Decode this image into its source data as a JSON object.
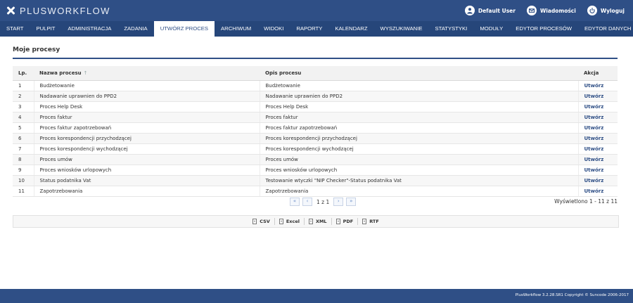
{
  "brand": {
    "logo_text": "PLUSWORKFLOW",
    "logo_icon": "cross-icon"
  },
  "user_menu": [
    {
      "label": "Default User",
      "icon": "user-icon"
    },
    {
      "label": "Wiadomości",
      "icon": "mail-icon"
    },
    {
      "label": "Wyloguj",
      "icon": "power-icon"
    }
  ],
  "menu": [
    "START",
    "PULPIT",
    "ADMINISTRACJA",
    "ZADANIA",
    "UTWÓRZ PROCES",
    "ARCHIWUM",
    "WIDOKI",
    "RAPORTY",
    "KALENDARZ",
    "WYSZUKIWANIE",
    "STATYSTYKI",
    "MODUŁY",
    "EDYTOR PROCESÓW",
    "EDYTOR DANYCH"
  ],
  "active_menu": "UTWÓRZ PROCES",
  "page": {
    "title": "Moje procesy"
  },
  "table": {
    "headers": {
      "lp": "Lp.",
      "name": "Nazwa procesu",
      "desc": "Opis procesu",
      "action": "Akcja"
    },
    "sort_icon": "↑",
    "rows": [
      {
        "lp": "1",
        "name": "Budżetowanie",
        "desc": "Budżetowanie",
        "action": "Utwórz"
      },
      {
        "lp": "2",
        "name": "Nadawanie uprawnien do PPD2",
        "desc": "Nadawanie uprawnien do PPD2",
        "action": "Utwórz"
      },
      {
        "lp": "3",
        "name": "Proces Help Desk",
        "desc": "Proces Help Desk",
        "action": "Utwórz"
      },
      {
        "lp": "4",
        "name": "Proces faktur",
        "desc": "Proces faktur",
        "action": "Utwórz"
      },
      {
        "lp": "5",
        "name": "Proces faktur zapotrzebowań",
        "desc": "Proces faktur zapotrzebowań",
        "action": "Utwórz"
      },
      {
        "lp": "6",
        "name": "Proces korespondencji przychodzącej",
        "desc": "Proces korespondencji przychodzącej",
        "action": "Utwórz"
      },
      {
        "lp": "7",
        "name": "Proces korespondencji wychodzącej",
        "desc": "Proces korespondencji wychodzącej",
        "action": "Utwórz"
      },
      {
        "lp": "8",
        "name": "Proces umów",
        "desc": "Proces umów",
        "action": "Utwórz"
      },
      {
        "lp": "9",
        "name": "Proces wniosków urlopowych",
        "desc": "Proces wniosków urlopowych",
        "action": "Utwórz"
      },
      {
        "lp": "10",
        "name": "Status podatnika Vat",
        "desc": "Testowanie wtyczki \"NIP Checker\"-Status podatnika Vat",
        "action": "Utwórz"
      },
      {
        "lp": "11",
        "name": "Zapotrzebowania",
        "desc": "Zapotrzebowania",
        "action": "Utwórz"
      }
    ]
  },
  "pagination": {
    "first": "«",
    "prev": "‹",
    "next": "›",
    "last": "»",
    "page_text": "1 z 1",
    "summary": "Wyświetlono 1 - 11 z 11"
  },
  "export": [
    "CSV",
    "Excel",
    "XML",
    "PDF",
    "RTF"
  ],
  "footer": {
    "text": "PlusWorkflow 3.2.28.SR1 Copyright © Suncode 2006-2017"
  },
  "colors": {
    "header_bg": "#2f4f86",
    "menu_bg": "#26467a",
    "link": "#2f4f86"
  }
}
